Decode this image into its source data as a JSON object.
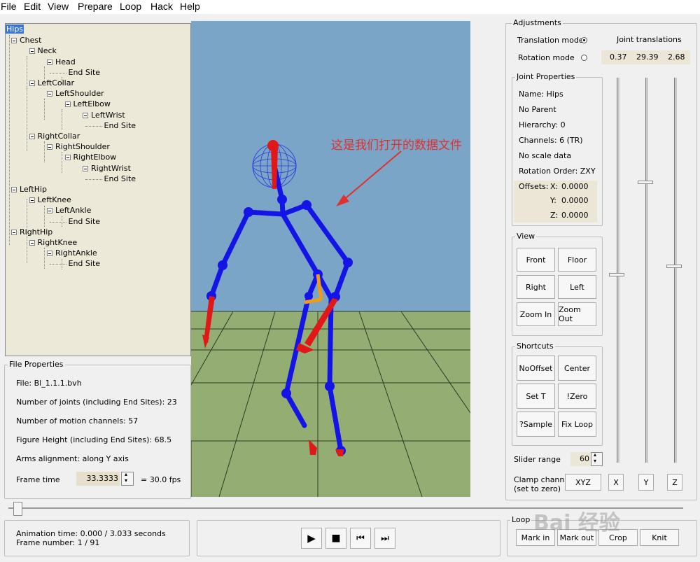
{
  "menu": [
    "File",
    "Edit",
    "View",
    "Prepare",
    "Loop",
    "Hack",
    "Help"
  ],
  "tree": [
    {
      "label": "Hips",
      "selected": true
    },
    {
      "label": "Chest"
    },
    {
      "label": "Neck"
    },
    {
      "label": "Head"
    },
    {
      "label": "End Site"
    },
    {
      "label": "LeftCollar"
    },
    {
      "label": "LeftShoulder"
    },
    {
      "label": "LeftElbow"
    },
    {
      "label": "LeftWrist"
    },
    {
      "label": "End Site"
    },
    {
      "label": "RightCollar"
    },
    {
      "label": "RightShoulder"
    },
    {
      "label": "RightElbow"
    },
    {
      "label": "RightWrist"
    },
    {
      "label": "End Site"
    },
    {
      "label": "LeftHip"
    },
    {
      "label": "LeftKnee"
    },
    {
      "label": "LeftAnkle"
    },
    {
      "label": "End Site"
    },
    {
      "label": "RightHip"
    },
    {
      "label": "RightKnee"
    },
    {
      "label": "RightAnkle"
    },
    {
      "label": "End Site"
    }
  ],
  "file_properties": {
    "title": "File Properties",
    "file": "File: Bl_1.1.1.bvh",
    "joints": "Number of joints (including End Sites): 23",
    "channels": "Number of motion channels: 57",
    "height": "Figure Height (including End Sites): 68.5",
    "arms": "Arms alignment: along Y axis",
    "frame_time_label": "Frame time",
    "frame_time_value": "33.3333",
    "fps": "=  30.0 fps"
  },
  "annotation": "这是我们打开的数据文件",
  "adjustments": {
    "title": "Adjustments",
    "translation_mode": "Translation mode",
    "rotation_mode": "Rotation mode",
    "joint_translations": "Joint translations",
    "tx": "0.37",
    "ty": "29.39",
    "tz": "2.68"
  },
  "joint_properties": {
    "title": "Joint Properties",
    "name": "Name: Hips",
    "parent": "No Parent",
    "hierarchy": "Hierarchy: 0",
    "channels": "Channels: 6 (TR)",
    "scale": "No scale data",
    "rotation_order": "Rotation Order: ZXY",
    "offsets_label": "Offsets:",
    "ox_label": "X:",
    "ox": "0.0000",
    "oy_label": "Y:",
    "oy": "0.0000",
    "oz_label": "Z:",
    "oz": "0.0000"
  },
  "view": {
    "title": "View",
    "front": "Front",
    "floor": "Floor",
    "right": "Right",
    "left": "Left",
    "zoom_in": "Zoom In",
    "zoom_out": "Zoom Out"
  },
  "shortcuts": {
    "title": "Shortcuts",
    "nooffset": "NoOffset",
    "center": "Center",
    "set_t": "Set T",
    "zero": "!Zero",
    "sample": "?Sample",
    "fix_loop": "Fix Loop"
  },
  "slider_range": {
    "label": "Slider range",
    "value": "60"
  },
  "clamp": {
    "label1": "Clamp channel",
    "label2": "(set to zero)",
    "xyz": "XYZ",
    "x": "X",
    "y": "Y",
    "z": "Z"
  },
  "status": {
    "animation_time": "Animation time: 0.000 / 3.033 seconds",
    "frame_number": "Frame number: 1 / 91"
  },
  "loop": {
    "title": "Loop",
    "mark_in": "Mark in",
    "mark_out": "Mark out",
    "crop": "Crop",
    "knit": "Knit"
  },
  "playback": {
    "position_fraction": 0.0
  },
  "watermark": "Bai 经验"
}
